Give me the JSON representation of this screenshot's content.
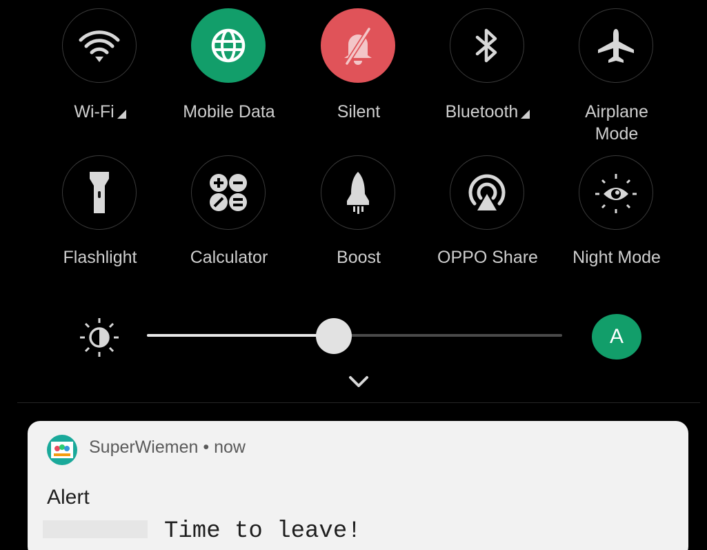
{
  "quick_settings": {
    "row1": [
      {
        "label": "Wi-Fi",
        "icon": "wifi-icon",
        "active": false,
        "has_expand": true
      },
      {
        "label": "Mobile Data",
        "icon": "globe-icon",
        "active": true,
        "active_color": "#129E6A",
        "has_expand": false
      },
      {
        "label": "Silent",
        "icon": "bell-off-icon",
        "active": true,
        "active_color": "#E05359",
        "has_expand": false
      },
      {
        "label": "Bluetooth",
        "icon": "bluetooth-icon",
        "active": false,
        "has_expand": true
      },
      {
        "label": "Airplane\nMode",
        "icon": "airplane-icon",
        "active": false,
        "has_expand": false
      }
    ],
    "row2": [
      {
        "label": "Flashlight",
        "icon": "flashlight-icon",
        "active": false
      },
      {
        "label": "Calculator",
        "icon": "calculator-icon",
        "active": false
      },
      {
        "label": "Boost",
        "icon": "rocket-icon",
        "active": false
      },
      {
        "label": "OPPO Share",
        "icon": "share-radar-icon",
        "active": false
      },
      {
        "label": "Night Mode",
        "icon": "eye-sun-icon",
        "active": false
      }
    ]
  },
  "brightness": {
    "level": 0.45,
    "auto_label": "A",
    "auto_color": "#129E6A"
  },
  "notification": {
    "app_name": "SuperWiemen",
    "separator": "•",
    "time": "now",
    "title": "Alert",
    "text": "Time to leave!"
  },
  "colors": {
    "background": "#000000",
    "tile_border": "#3a3a3a",
    "label": "#cfcfcf",
    "card": "#f2f2f2"
  }
}
